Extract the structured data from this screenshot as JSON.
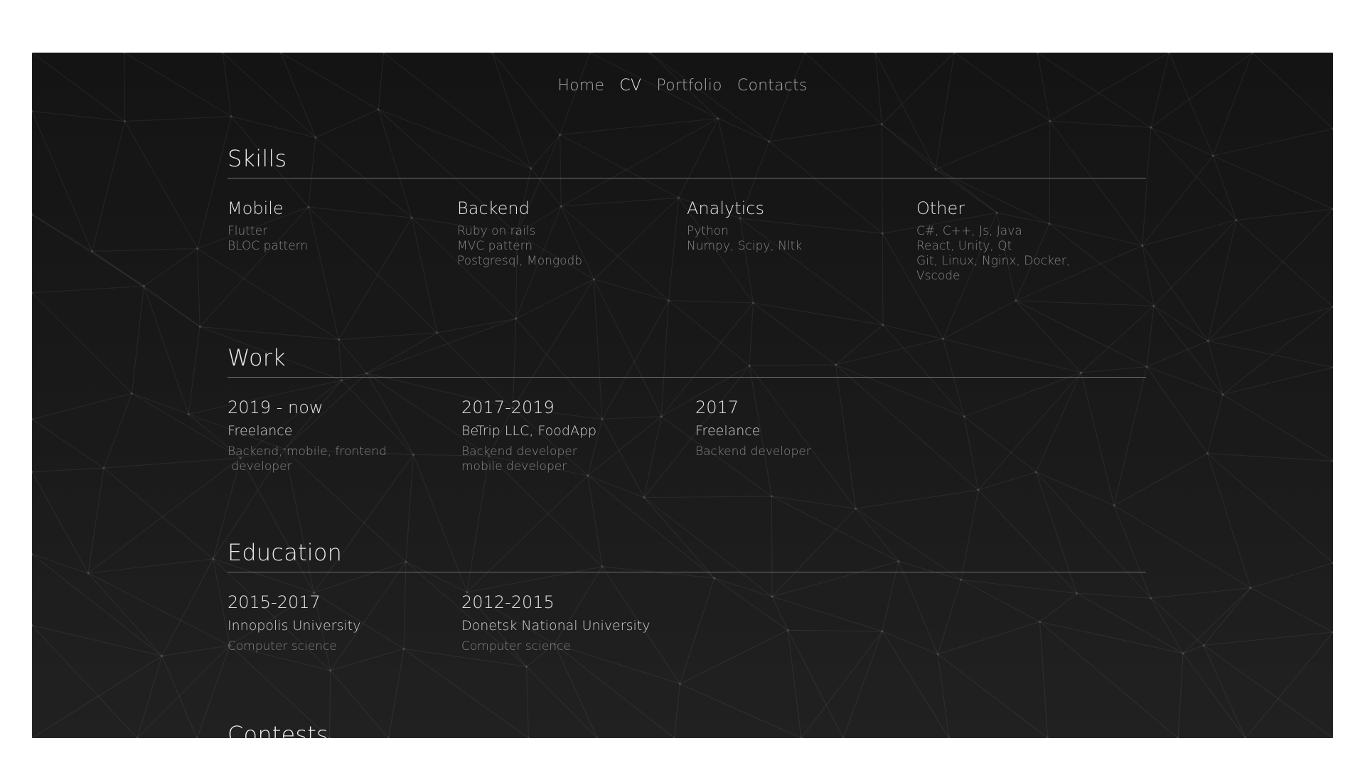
{
  "nav": {
    "items": [
      {
        "label": "Home",
        "active": false
      },
      {
        "label": "CV",
        "active": true
      },
      {
        "label": "Portfolio",
        "active": false
      },
      {
        "label": "Contacts",
        "active": false
      }
    ]
  },
  "skills": {
    "title": "Skills",
    "columns": [
      {
        "title": "Mobile",
        "lines": [
          "Flutter",
          "BLOC pattern"
        ]
      },
      {
        "title": "Backend",
        "lines": [
          "Ruby on rails",
          "MVC pattern",
          "Postgresql, Mongodb"
        ]
      },
      {
        "title": "Analytics",
        "lines": [
          "Python",
          "Numpy, Scipy, Nltk"
        ]
      },
      {
        "title": "Other",
        "lines": [
          "C#, C++, Js, Java",
          "React, Unity, Qt",
          "Git, Linux, Nginx, Docker,",
          "Vscode"
        ]
      }
    ]
  },
  "work": {
    "title": "Work",
    "columns": [
      {
        "period": "2019 - now",
        "org": "Freelance",
        "lines": [
          "Backend, mobile, frontend",
          " developer"
        ]
      },
      {
        "period": "2017-2019",
        "org": "BeTrip LLC, FoodApp",
        "lines": [
          "Backend developer",
          "mobile developer"
        ]
      },
      {
        "period": "2017",
        "org": "Freelance",
        "lines": [
          "Backend developer"
        ]
      }
    ]
  },
  "education": {
    "title": "Education",
    "columns": [
      {
        "period": "2015-2017",
        "org": "Innopolis University",
        "lines": [
          "Computer science"
        ]
      },
      {
        "period": "2012-2015",
        "org": "Donetsk National University",
        "lines": [
          "Computer science"
        ]
      }
    ]
  },
  "contests": {
    "title": "Contests"
  },
  "colors": {
    "background": "#1a1a1a",
    "title": "#e9e9e9",
    "muted": "#878787",
    "nav_inactive": "#a9a9a9",
    "divider": "#6f6f6f"
  }
}
